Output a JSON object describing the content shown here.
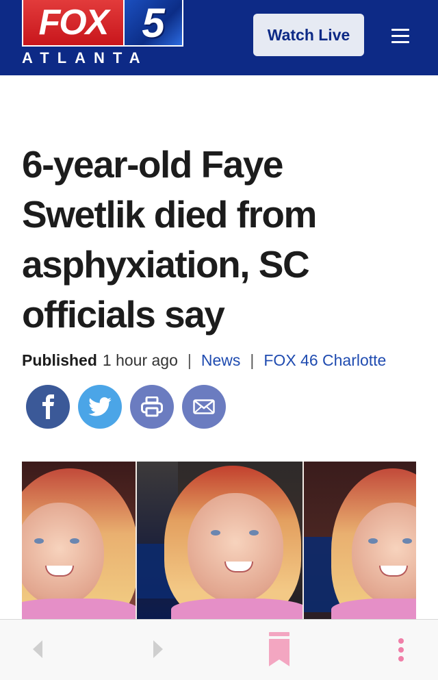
{
  "header": {
    "logo": {
      "brand": "FOX",
      "channel": "5",
      "city": "ATLANTA"
    },
    "watch_live_label": "Watch Live",
    "menu_icon": "hamburger-menu-icon",
    "background_color": "#0d2a86"
  },
  "article": {
    "headline": "6-year-old Faye Swetlik died from asphyxiation, SC officials say",
    "byline": {
      "published_label": "Published",
      "published_time": "1 hour ago",
      "category": "News",
      "source": "FOX 46 Charlotte"
    },
    "share_buttons": [
      {
        "icon": "facebook-icon",
        "color": "#3b5998"
      },
      {
        "icon": "twitter-icon",
        "color": "#4ba5e7"
      },
      {
        "icon": "print-icon",
        "color": "#6b7cc0"
      },
      {
        "icon": "email-icon",
        "color": "#6b7cc0"
      }
    ],
    "photo": {
      "description_icon": "article-photo"
    }
  },
  "toolbar": {
    "items": [
      {
        "icon": "back-arrow-icon"
      },
      {
        "icon": "forward-arrow-icon"
      },
      {
        "icon": "bookmark-icon",
        "color": "#f3a6c1"
      },
      {
        "icon": "more-options-icon",
        "color": "#ef7fa8"
      }
    ]
  }
}
